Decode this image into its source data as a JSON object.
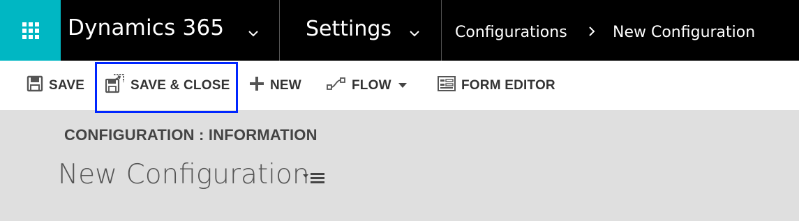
{
  "nav": {
    "app_name": "Dynamics 365",
    "area_name": "Settings",
    "breadcrumb": [
      "Configurations",
      "New Configuration"
    ],
    "brand_color": "#00b7c3",
    "icons": {
      "launcher": "waffle-icon",
      "dropdown": "chevron-down-icon",
      "separator": "chevron-right-icon"
    }
  },
  "commands": {
    "save": "SAVE",
    "save_close": "SAVE & CLOSE",
    "new": "NEW",
    "flow": "FLOW",
    "form_editor": "FORM EDITOR",
    "focus_color": "#0026ff"
  },
  "form": {
    "entity_label": "CONFIGURATION : INFORMATION",
    "record_name": "New Configuration"
  }
}
